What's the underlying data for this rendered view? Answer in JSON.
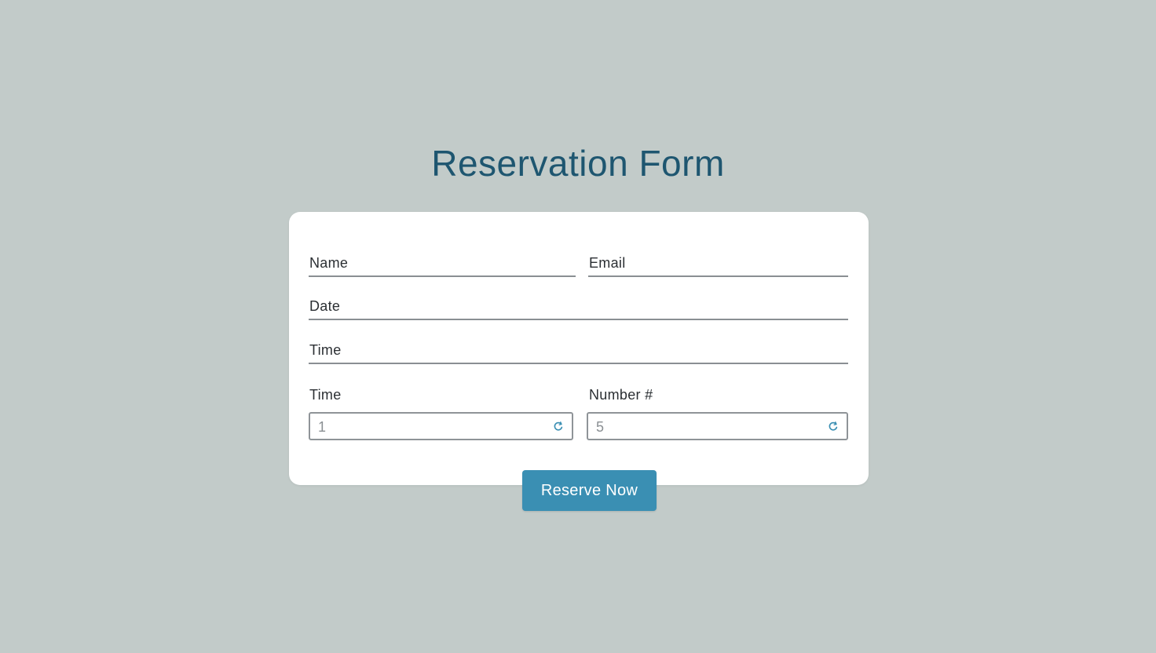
{
  "page": {
    "title": "Reservation Form"
  },
  "form": {
    "name_label": "Name",
    "email_label": "Email",
    "date_label": "Date",
    "time_label": "Time",
    "time2_label": "Time",
    "number_label": "Number #",
    "time_value": "1",
    "number_value": "5",
    "submit_label": "Reserve Now"
  },
  "colors": {
    "background": "#c2cbc9",
    "title": "#1e5670",
    "button": "#3a8fb3",
    "card": "#ffffff"
  },
  "icons": {
    "stepper_icon": "spin-arrows-icon"
  }
}
